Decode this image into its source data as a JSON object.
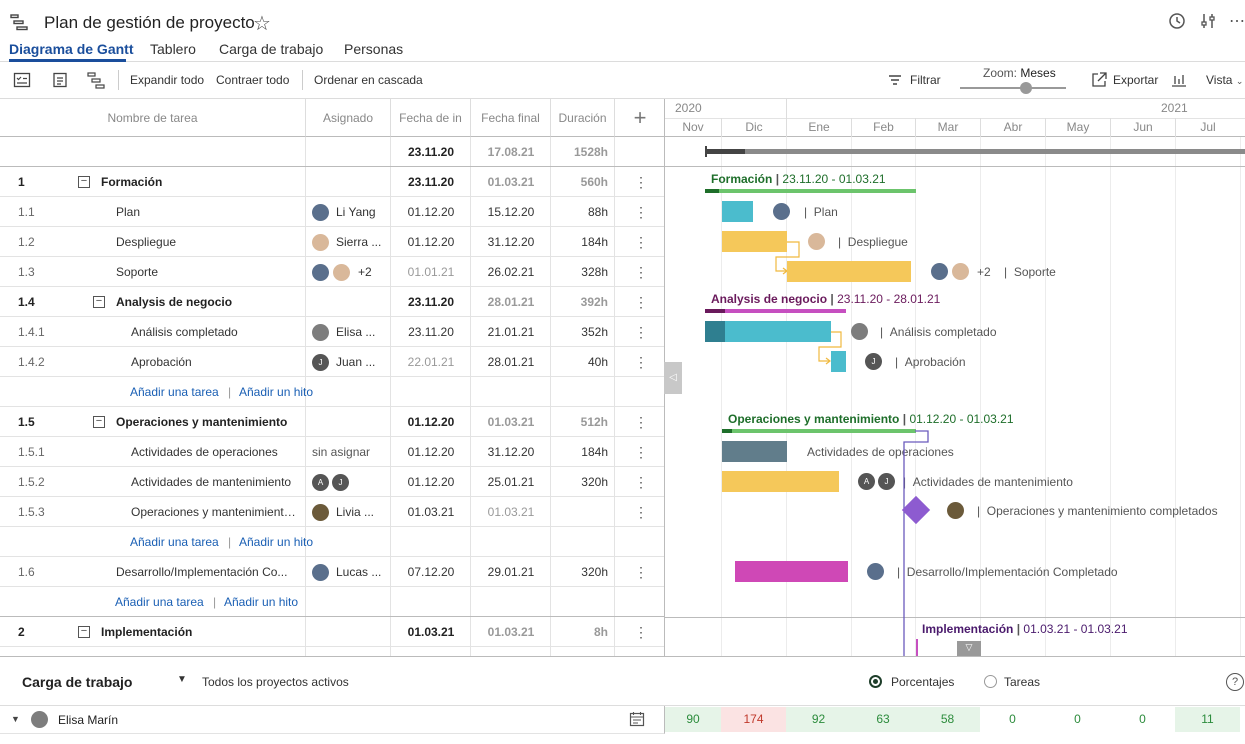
{
  "header": {
    "title": "Plan de gestión de proyecto",
    "tabs": [
      "Diagrama de Gantt",
      "Tablero",
      "Carga de trabajo",
      "Personas"
    ]
  },
  "toolbar": {
    "expand": "Expandir todo",
    "collapse": "Contraer todo",
    "cascade": "Ordenar en cascada",
    "filter": "Filtrar",
    "zoom_label": "Zoom:",
    "zoom_value": "Meses",
    "export": "Exportar",
    "view": "Vista"
  },
  "grid": {
    "columns": [
      "Nombre de tarea",
      "Asignado",
      "Fecha de in",
      "Fecha final",
      "Duración"
    ],
    "summary": {
      "start": "23.11.20",
      "end": "17.08.21",
      "duration": "1528h"
    },
    "rows": [
      {
        "id": "1",
        "name": "Formación",
        "assignee": "",
        "start": "23.11.20",
        "end": "01.03.21",
        "dur": "560h"
      },
      {
        "id": "1.1",
        "name": "Plan",
        "assignee": "Li Yang",
        "start": "01.12.20",
        "end": "15.12.20",
        "dur": "88h"
      },
      {
        "id": "1.2",
        "name": "Despliegue",
        "assignee": "Sierra ...",
        "start": "01.12.20",
        "end": "31.12.20",
        "dur": "184h"
      },
      {
        "id": "1.3",
        "name": "Soporte",
        "assignee": "+2",
        "start": "01.01.21",
        "end": "26.02.21",
        "dur": "328h"
      },
      {
        "id": "1.4",
        "name": "Analysis de negocio",
        "assignee": "",
        "start": "23.11.20",
        "end": "28.01.21",
        "dur": "392h"
      },
      {
        "id": "1.4.1",
        "name": "Análisis completado",
        "assignee": "Elisa ...",
        "start": "23.11.20",
        "end": "21.01.21",
        "dur": "352h"
      },
      {
        "id": "1.4.2",
        "name": "Aprobación",
        "assignee": "Juan ...",
        "start": "22.01.21",
        "end": "28.01.21",
        "dur": "40h"
      },
      {
        "id": "1.5",
        "name": "Operaciones y mantenimiento",
        "assignee": "",
        "start": "01.12.20",
        "end": "01.03.21",
        "dur": "512h"
      },
      {
        "id": "1.5.1",
        "name": "Actividades de operaciones",
        "assignee": "sin asignar",
        "start": "01.12.20",
        "end": "31.12.20",
        "dur": "184h"
      },
      {
        "id": "1.5.2",
        "name": "Actividades de mantenimiento",
        "assignee": "",
        "start": "01.12.20",
        "end": "25.01.21",
        "dur": "320h"
      },
      {
        "id": "1.5.3",
        "name": "Operaciones y mantenimiento ...",
        "assignee": "Livia ...",
        "start": "01.03.21",
        "end": "01.03.21",
        "dur": ""
      },
      {
        "id": "1.6",
        "name": "Desarrollo/Implementación Co...",
        "assignee": "Lucas ...",
        "start": "07.12.20",
        "end": "29.01.21",
        "dur": "320h"
      },
      {
        "id": "2",
        "name": "Implementación",
        "assignee": "",
        "start": "01.03.21",
        "end": "01.03.21",
        "dur": "8h"
      }
    ],
    "add_task": "Añadir una tarea",
    "add_milestone": "Añadir un hito"
  },
  "gantt": {
    "years": [
      "2020",
      "2021"
    ],
    "months": [
      "Nov",
      "Dic",
      "Ene",
      "Feb",
      "Mar",
      "Abr",
      "May",
      "Jun",
      "Jul"
    ],
    "labels": {
      "formacion": "Formación",
      "formacion_dates": "23.11.20 - 01.03.21",
      "plan": "Plan",
      "despliegue": "Despliegue",
      "soporte": "Soporte",
      "plus2": "+2",
      "analysis": "Analysis de negocio",
      "analysis_dates": "23.11.20 - 28.01.21",
      "analisis_completado": "Análisis completado",
      "aprobacion": "Aprobación",
      "operaciones": "Operaciones y mantenimiento",
      "operaciones_dates": "01.12.20 - 01.03.21",
      "act_operaciones": "Actividades de operaciones",
      "act_mantenimiento": "Actividades de mantenimiento",
      "op_completados": "Operaciones y mantenimiento completados",
      "desarrollo": "Desarrollo/Implementación Completado",
      "implementacion": "Implementación",
      "implementacion_dates": "01.03.21 - 01.03.21"
    },
    "colors": {
      "teal": "#4bbccd",
      "yellow": "#f5c85a",
      "slate": "#617d8b",
      "magenta": "#cf48b6",
      "diamond": "#8d5bd0",
      "green_line": "#6cc46c",
      "purple_line": "#c64fc0"
    }
  },
  "workload": {
    "title": "Carga de trabajo",
    "filter": "Todos los proyectos activos",
    "opt_percent": "Porcentajes",
    "opt_tasks": "Tareas",
    "person": "Elisa Marín",
    "values": [
      "90",
      "174",
      "92",
      "63",
      "58",
      "0",
      "0",
      "0",
      "11"
    ]
  }
}
